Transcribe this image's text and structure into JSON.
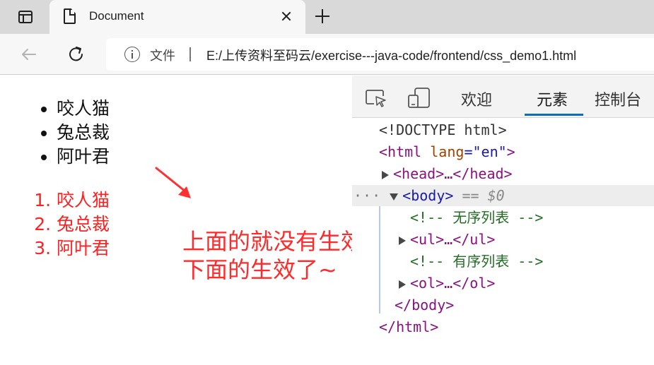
{
  "browser": {
    "tab": {
      "title": "Document",
      "close_icon": "close-icon"
    },
    "address": {
      "file_label": "文件",
      "separator": "|",
      "url": "E:/上传资料至码云/exercise---java-code/frontend/css_demo1.html"
    }
  },
  "page": {
    "ul_items": [
      "咬人猫",
      "兔总裁",
      "阿叶君"
    ],
    "ol_items": [
      "咬人猫",
      "兔总裁",
      "阿叶君"
    ],
    "annotation": {
      "line1": "上面的就没有生效，",
      "line2": "下面的生效了~",
      "color": "#ff2a2a"
    },
    "ol_color": "#ff2020"
  },
  "devtools": {
    "tabs": {
      "welcome": "欢迎",
      "elements": "元素",
      "console": "控制台"
    },
    "active_color": "#0f6cbd",
    "dom": {
      "doctype": "<!DOCTYPE html>",
      "html_open": "<html",
      "lang_attr": "lang",
      "lang_val": "\"en\"",
      "close_bracket": ">",
      "head_line": "<head>…</head>",
      "dots": "···",
      "body_open": "<body>",
      "body_marker": "== $0",
      "comment_ul": "<!-- 无序列表 -->",
      "ul_line": "<ul>…</ul>",
      "comment_ol": "<!-- 有序列表 -->",
      "ol_line": "<ol>…</ol>",
      "body_close": "</body>",
      "html_close": "</html>"
    }
  }
}
